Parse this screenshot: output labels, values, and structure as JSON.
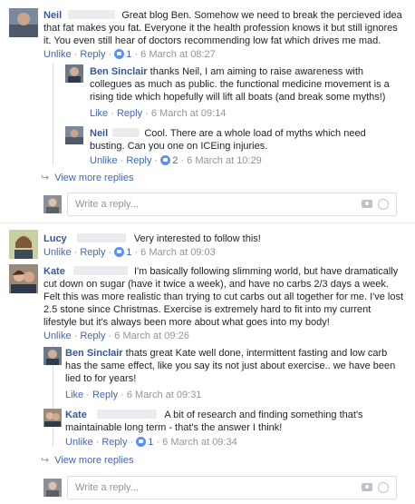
{
  "thread1": {
    "neil": {
      "name": "Neil",
      "text_line1": "Great blog Ben. Somehow we need to break the percieved idea that",
      "text_rest": "fat makes you fat. Everyone it the health profession knows it but still ignores it. You even still hear of doctors recommending low fat which drives me mad.",
      "unlike": "Unlike",
      "reply": "Reply",
      "likes": "1",
      "time": "6 March at 08:27"
    },
    "ben_reply": {
      "name": "Ben Sinclair",
      "text": "thanks Neil, I am aiming to raise awareness with collegues as much as public. the functional medicine movement is a rising tide which hopefully will lift all boats (and break some myths!)",
      "like": "Like",
      "reply": "Reply",
      "time": "6 March at 09:14"
    },
    "neil_reply": {
      "name": "Neil",
      "text_line1": "Cool. There are a whole load of myths which need busting.",
      "text_rest": "Can you one on ICEing injuries.",
      "unlike": "Unlike",
      "reply": "Reply",
      "likes": "2",
      "time": "6 March at 10:29"
    },
    "view_more": "View more replies",
    "reply_placeholder": "Write a reply..."
  },
  "lucy": {
    "name": "Lucy",
    "text": "Very interested to follow this!",
    "unlike": "Unlike",
    "reply": "Reply",
    "likes": "1",
    "time": "6 March at 09:03"
  },
  "thread2": {
    "kate": {
      "name": "Kate",
      "text_line1": "I'm basically following slimming world, but have dramatically",
      "text_rest": "cut down on sugar (have it twice a week), and have no carbs 2/3 days a week. Felt this was more realistic than trying to cut carbs out all together for me. I've lost 2.5 stone since Christmas. Exercise is extremely hard to fit into my current lifestyle but it's always been more about what goes into my body!",
      "unlike": "Unlike",
      "reply": "Reply",
      "time": "6 March at 09:26"
    },
    "ben_reply": {
      "name": "Ben Sinclair",
      "text": "thats great Kate well done, intermittent fasting and low carb has the same effect, like you say its not just about exercise.. we have been lied to for years!",
      "like": "Like",
      "reply": "Reply",
      "time": "6 March at 09:31"
    },
    "kate_reply": {
      "name": "Kate",
      "text_line1": "A bit of research and finding something that's",
      "text_rest": "maintainable long term - that's the answer I think!",
      "unlike": "Unlike",
      "reply": "Reply",
      "likes": "1",
      "time": "6 March at 09:34"
    },
    "view_more": "View more replies",
    "reply_placeholder": "Write a reply..."
  },
  "icons": {
    "like": "like-thumb-icon",
    "arrow": "reply-arrow-icon",
    "camera": "camera-icon",
    "emoji": "emoji-icon"
  },
  "colors": {
    "link": "#4267b2",
    "name": "#365899",
    "meta": "#90949c",
    "like": "#5890ff"
  }
}
